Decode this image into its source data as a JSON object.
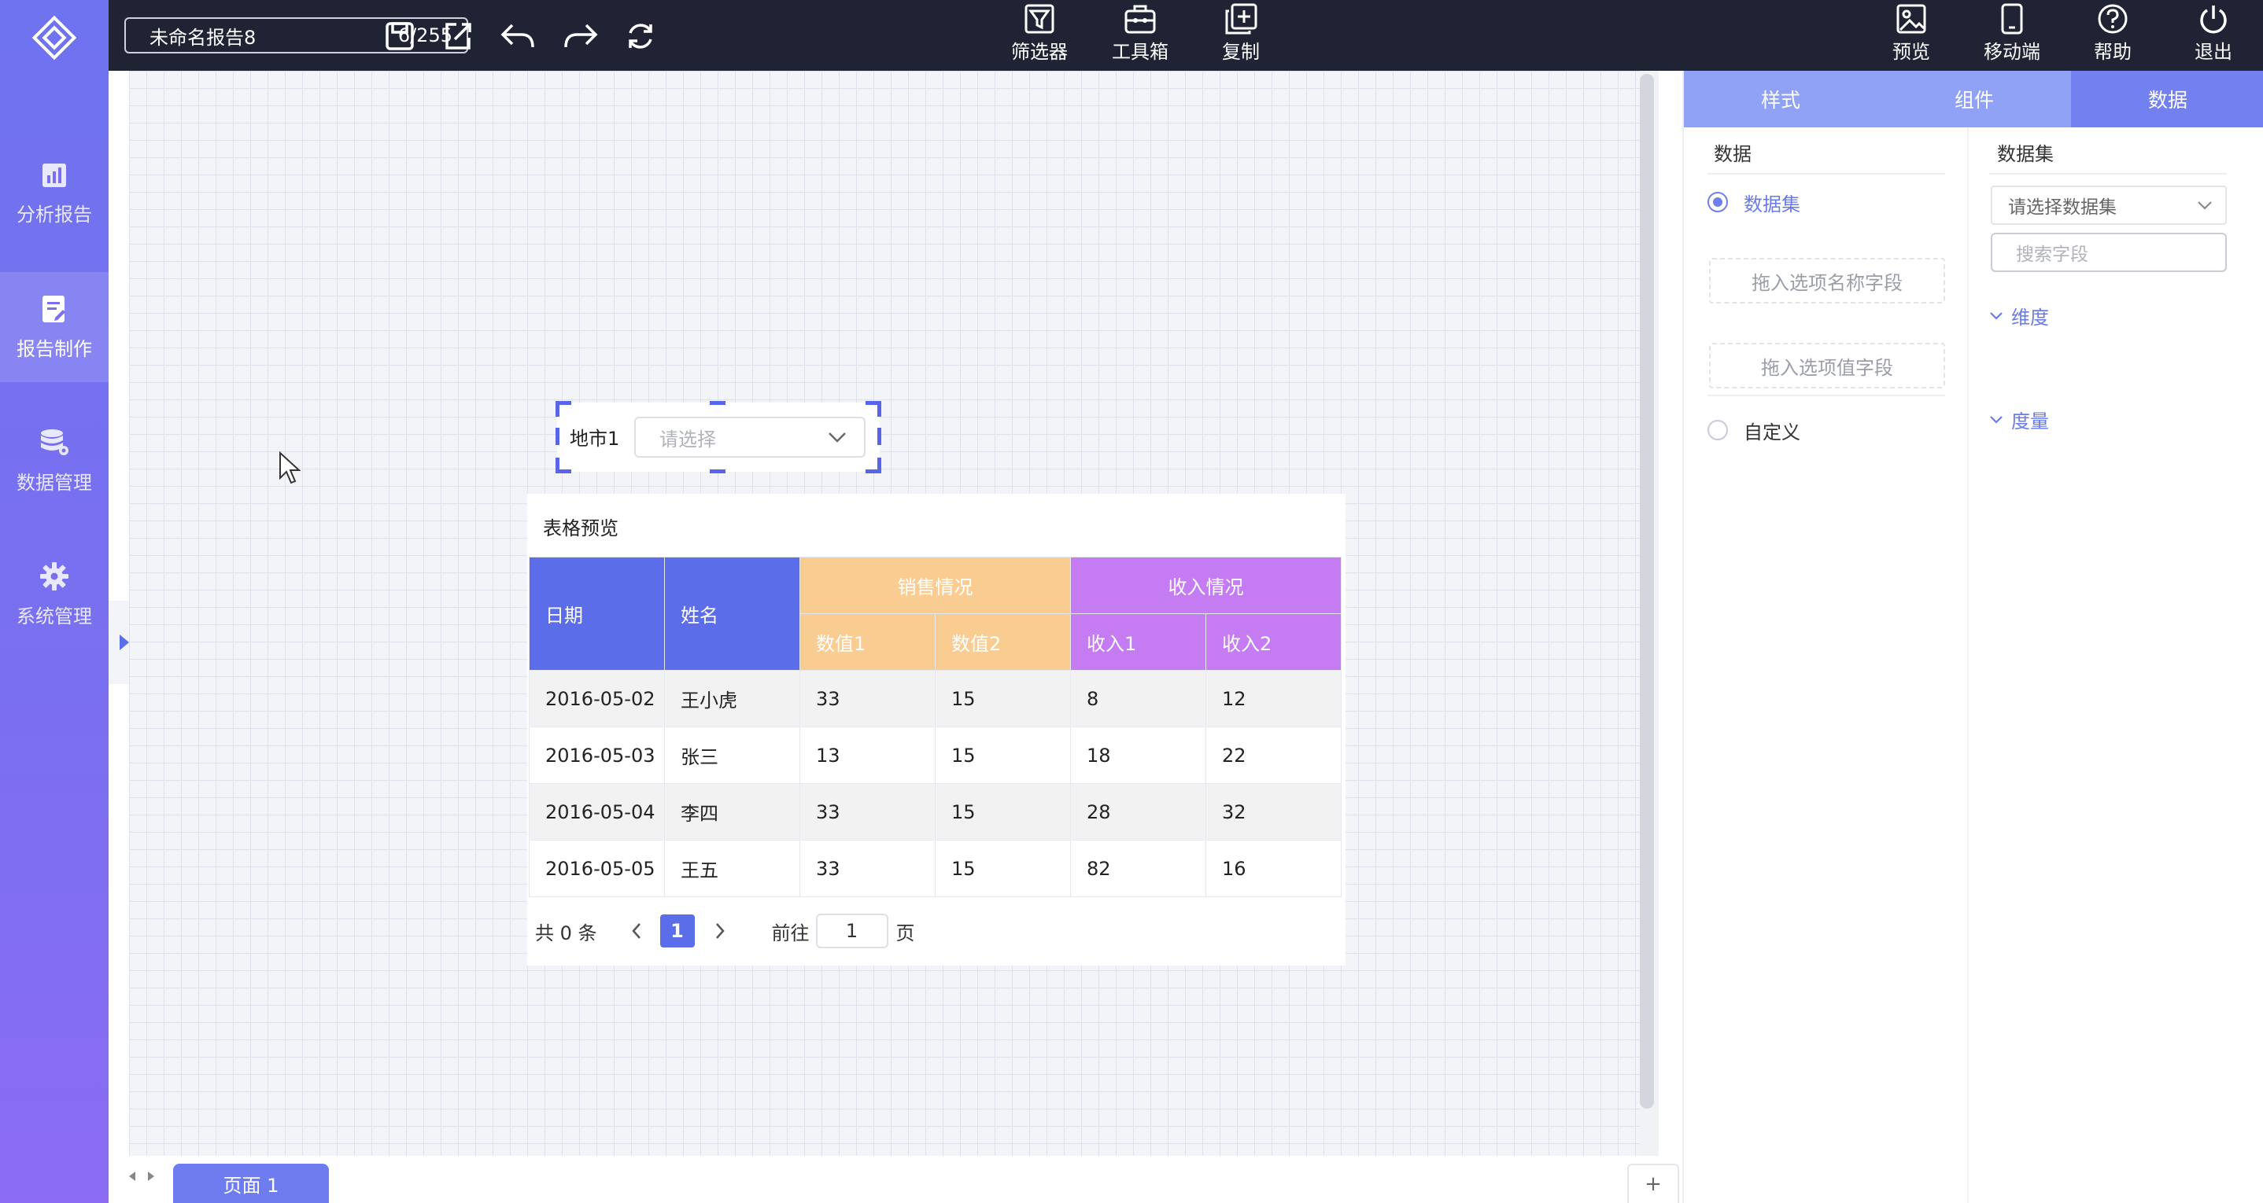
{
  "sidebar": {
    "items": [
      {
        "label": "分析报告",
        "icon": "analysis-report-icon"
      },
      {
        "label": "报告制作",
        "icon": "report-edit-icon",
        "active": true
      },
      {
        "label": "数据管理",
        "icon": "database-icon"
      },
      {
        "label": "系统管理",
        "icon": "gear-icon"
      }
    ]
  },
  "topbar": {
    "report_name": "未命名报告8",
    "char_count": "6/255",
    "filter_label": "筛选器",
    "toolbox_label": "工具箱",
    "copy_label": "复制",
    "preview_label": "预览",
    "mobile_label": "移动端",
    "help_label": "帮助",
    "logout_label": "退出"
  },
  "filter_widget": {
    "label": "地市1",
    "placeholder": "请选择"
  },
  "table_preview": {
    "title": "表格预览",
    "headers": {
      "date": "日期",
      "name": "姓名",
      "sales_group": "销售情况",
      "income_group": "收入情况",
      "value1": "数值1",
      "value2": "数值2",
      "income1": "收入1",
      "income2": "收入2"
    },
    "rows": [
      {
        "date": "2016-05-02",
        "name": "王小虎",
        "value1": "33",
        "value2": "15",
        "income1": "8",
        "income2": "12"
      },
      {
        "date": "2016-05-03",
        "name": "张三",
        "value1": "13",
        "value2": "15",
        "income1": "18",
        "income2": "22"
      },
      {
        "date": "2016-05-04",
        "name": "李四",
        "value1": "33",
        "value2": "15",
        "income1": "28",
        "income2": "32"
      },
      {
        "date": "2016-05-05",
        "name": "王五",
        "value1": "33",
        "value2": "15",
        "income1": "82",
        "income2": "16"
      }
    ],
    "pagination": {
      "total": "共 0 条",
      "current_page": "1",
      "goto_label": "前往",
      "goto_value": "1",
      "page_suffix": "页"
    }
  },
  "bottom": {
    "page_tab": "页面 1",
    "add_label": "+"
  },
  "right_panel": {
    "tabs": [
      "样式",
      "组件",
      "数据"
    ],
    "active_tab": "数据",
    "data_section": {
      "title": "数据",
      "option_dataset": "数据集",
      "drop_name": "拖入选项名称字段",
      "drop_value": "拖入选项值字段",
      "option_custom": "自定义"
    },
    "dataset_section": {
      "title": "数据集",
      "select_placeholder": "请选择数据集",
      "search_placeholder": "搜索字段",
      "dimension": "维度",
      "measure": "度量"
    }
  },
  "colors": {
    "accent": "#5b6de8",
    "topbar": "#1f2334",
    "sales_header": "#f9cd91",
    "income_header": "#c57cf2"
  }
}
